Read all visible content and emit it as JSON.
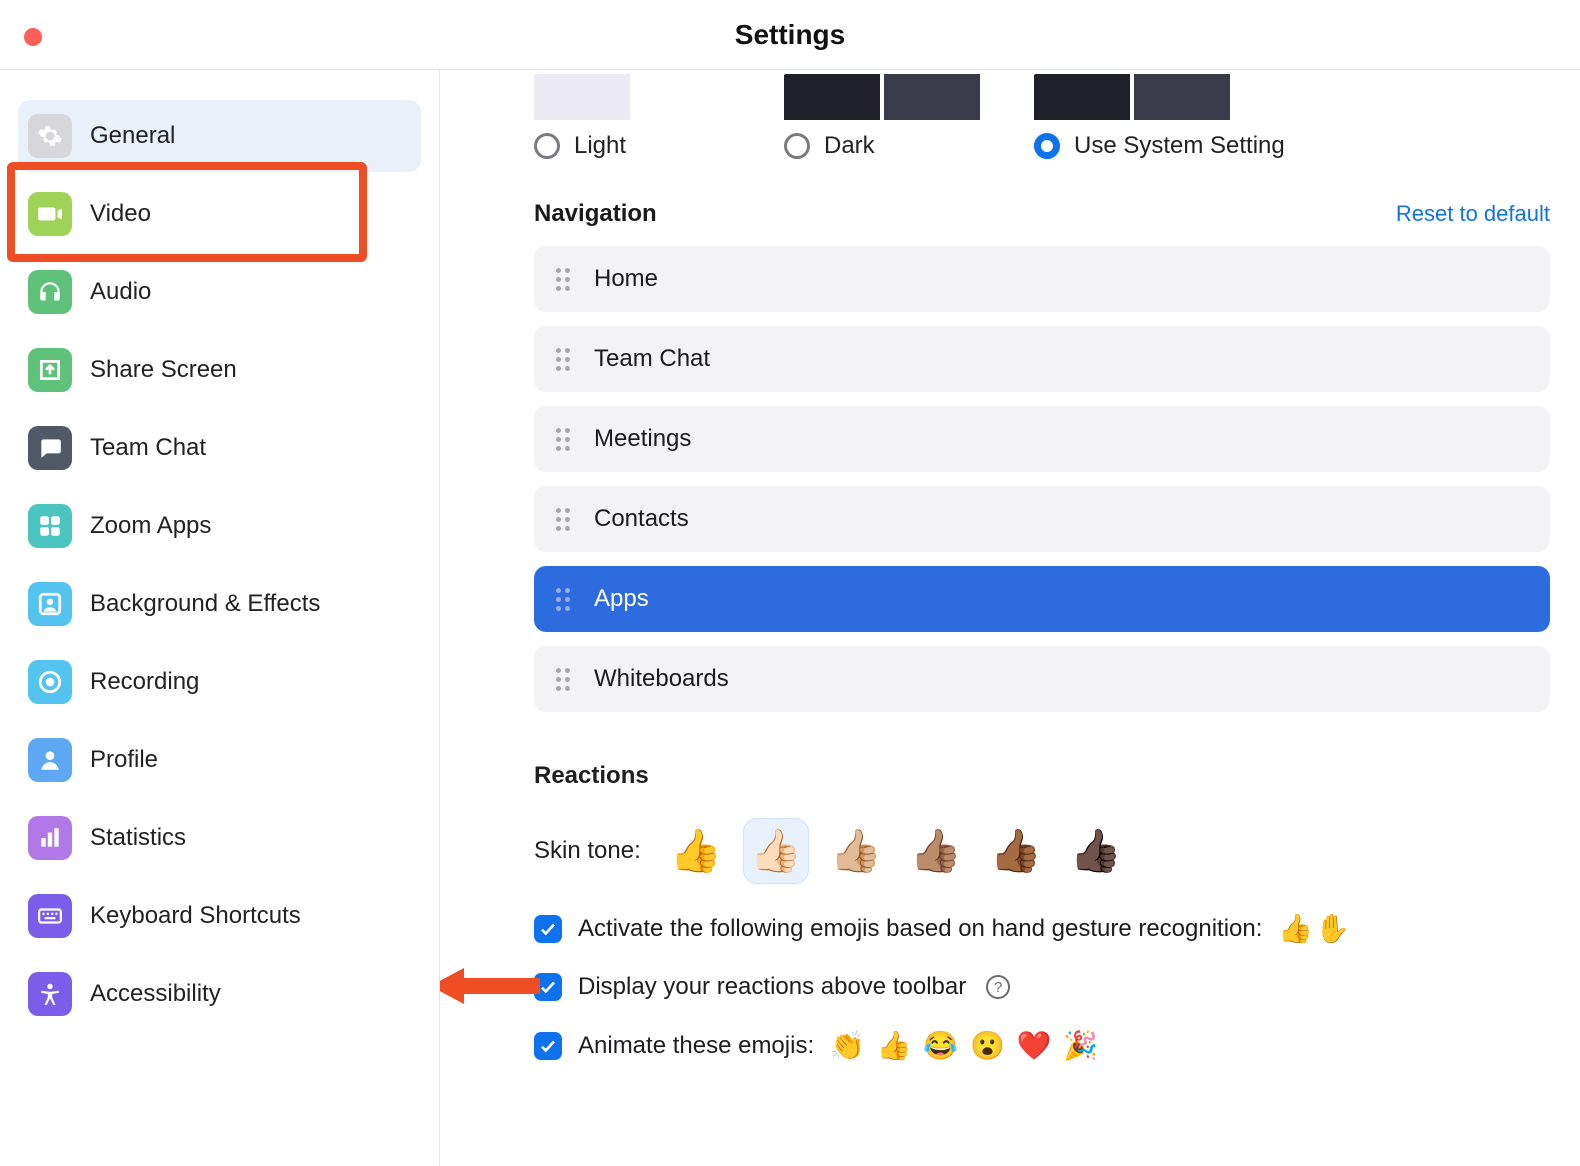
{
  "title": "Settings",
  "sidebar": {
    "items": [
      {
        "label": "General",
        "icon": "gear",
        "color": "#d7d7db",
        "selected": true
      },
      {
        "label": "Video",
        "icon": "video",
        "color": "#9fd357"
      },
      {
        "label": "Audio",
        "icon": "audio",
        "color": "#5ec27a"
      },
      {
        "label": "Share Screen",
        "icon": "share",
        "color": "#5ec27a"
      },
      {
        "label": "Team Chat",
        "icon": "chat",
        "color": "#4f5a66"
      },
      {
        "label": "Zoom Apps",
        "icon": "apps",
        "color": "#4cc4c0"
      },
      {
        "label": "Background & Effects",
        "icon": "effects",
        "color": "#55c3f0"
      },
      {
        "label": "Recording",
        "icon": "record",
        "color": "#55c3f0"
      },
      {
        "label": "Profile",
        "icon": "profile",
        "color": "#5ea7f2"
      },
      {
        "label": "Statistics",
        "icon": "stats",
        "color": "#b178e8"
      },
      {
        "label": "Keyboard Shortcuts",
        "icon": "keyboard",
        "color": "#7a5de8"
      },
      {
        "label": "Accessibility",
        "icon": "a11y",
        "color": "#7a5de8"
      }
    ]
  },
  "theme": {
    "options": [
      {
        "label": "Light",
        "checked": false,
        "left": "#eceaf5",
        "right": "#ffffff"
      },
      {
        "label": "Dark",
        "checked": false,
        "left": "#1f2029",
        "right": "#3a3b48"
      },
      {
        "label": "Use System Setting",
        "checked": true,
        "left": "#1f2029",
        "right": "#3a3b48"
      }
    ]
  },
  "navigation": {
    "title": "Navigation",
    "reset": "Reset to default",
    "items": [
      {
        "label": "Home",
        "active": false
      },
      {
        "label": "Team Chat",
        "active": false
      },
      {
        "label": "Meetings",
        "active": false
      },
      {
        "label": "Contacts",
        "active": false
      },
      {
        "label": "Apps",
        "active": true
      },
      {
        "label": "Whiteboards",
        "active": false
      }
    ]
  },
  "reactions": {
    "title": "Reactions",
    "skin_label": "Skin tone:",
    "skins": [
      "👍",
      "👍🏻",
      "👍🏼",
      "👍🏽",
      "👍🏾",
      "👍🏿"
    ],
    "skin_selected_index": 1,
    "checks": [
      {
        "label": "Activate the following emojis based on hand gesture recognition:",
        "emojis": "👍✋",
        "checked": true,
        "help": false
      },
      {
        "label": "Display your reactions above toolbar",
        "emojis": "",
        "checked": true,
        "help": true
      },
      {
        "label": "Animate these emojis: ",
        "emojis": "👏 👍 😂 😮 ❤️ 🎉",
        "checked": true,
        "help": false
      }
    ]
  }
}
